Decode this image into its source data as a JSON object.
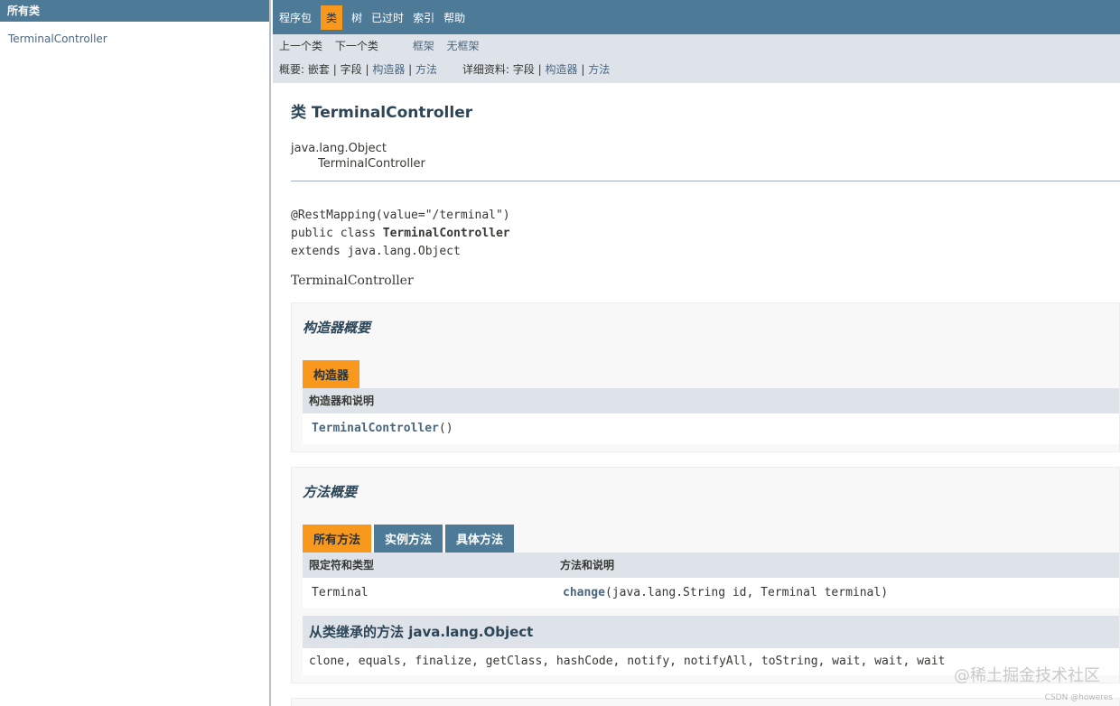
{
  "left": {
    "header": "所有类",
    "items": [
      "TerminalController"
    ]
  },
  "topnav": {
    "items": [
      "程序包",
      "类",
      "树",
      "已过时",
      "索引",
      "帮助"
    ],
    "active_index": 1
  },
  "subnav": {
    "prev_class": "上一个类",
    "next_class": "下一个类",
    "frames": "框架",
    "no_frames": "无框架",
    "summary_label": "概要:",
    "nested": "嵌套",
    "field": "字段",
    "constructor": "构造器",
    "method": "方法",
    "detail_label": "详细资料:",
    "d_field": "字段",
    "d_constructor": "构造器",
    "d_method": "方法",
    "sep": "|"
  },
  "class": {
    "title": "类 TerminalController",
    "hierarchy": [
      "java.lang.Object",
      "TerminalController"
    ],
    "annotation": "@RestMapping(value=\"/terminal\")",
    "decl_prefix": "public class ",
    "decl_name": "TerminalController",
    "extends_line": "extends java.lang.Object",
    "description": "TerminalController"
  },
  "constructor_summary": {
    "title": "构造器概要",
    "tab": "构造器",
    "header": "构造器和说明",
    "rows": [
      {
        "name": "TerminalController",
        "params": "()"
      }
    ]
  },
  "method_summary": {
    "title": "方法概要",
    "tabs": [
      "所有方法",
      "实例方法",
      "具体方法"
    ],
    "active_tab": 0,
    "headers": [
      "限定符和类型",
      "方法和说明"
    ],
    "rows": [
      {
        "type": "Terminal",
        "name": "change",
        "params": "(java.lang.String id, Terminal terminal)"
      }
    ],
    "inherited_title": "从类继承的方法 java.lang.Object",
    "inherited_methods": "clone, equals, finalize, getClass, hashCode, notify, notifyAll, toString, wait, wait, wait"
  },
  "watermark": {
    "main": "@稀土掘金技术社区",
    "small": "CSDN @howeres"
  }
}
